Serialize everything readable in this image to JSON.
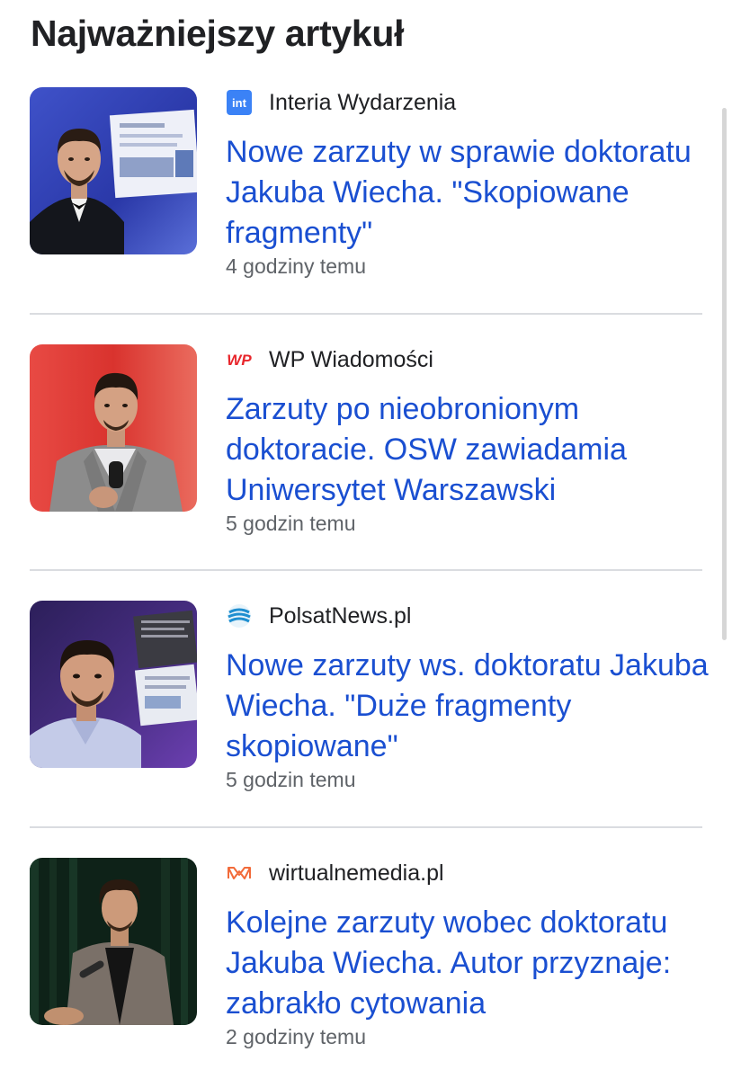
{
  "section": {
    "heading": "Najważniejszy artykuł"
  },
  "articles": [
    {
      "source": "Interia Wydarzenia",
      "source_icon": "interia-logo-icon",
      "source_icon_text": "int",
      "source_color": "#3b82f6",
      "title": "Nowe zarzuty w sprawie doktoratu Jakuba Wiecha. \"Skopiowane fragmenty\"",
      "time": "4 godziny temu"
    },
    {
      "source": "WP Wiadomości",
      "source_icon": "wp-logo-icon",
      "source_icon_text": "WP",
      "source_color": "#e8262c",
      "title": "Zarzuty po nieobronionym doktoracie. OSW zawiadamia Uniwersytet Warszawski",
      "time": "5 godzin temu"
    },
    {
      "source": "PolsatNews.pl",
      "source_icon": "polsatnews-logo-icon",
      "source_color": "#1f8fd0",
      "title": "Nowe zarzuty ws. doktoratu Jakuba Wiecha. \"Duże fragmenty skopiowane\"",
      "time": "5 godzin temu"
    },
    {
      "source": "wirtualnemedia.pl",
      "source_icon": "wirtualnemedia-logo-icon",
      "source_color": "#f26b3a",
      "title": "Kolejne zarzuty wobec doktoratu Jakuba Wiecha. Autor przyznaje: zabrakło cytowania",
      "time": "2 godziny temu"
    }
  ],
  "colors": {
    "headline_link": "#1a4fd1",
    "heading_text": "#202124",
    "meta_text": "#5f6368",
    "divider": "#dadce0"
  }
}
